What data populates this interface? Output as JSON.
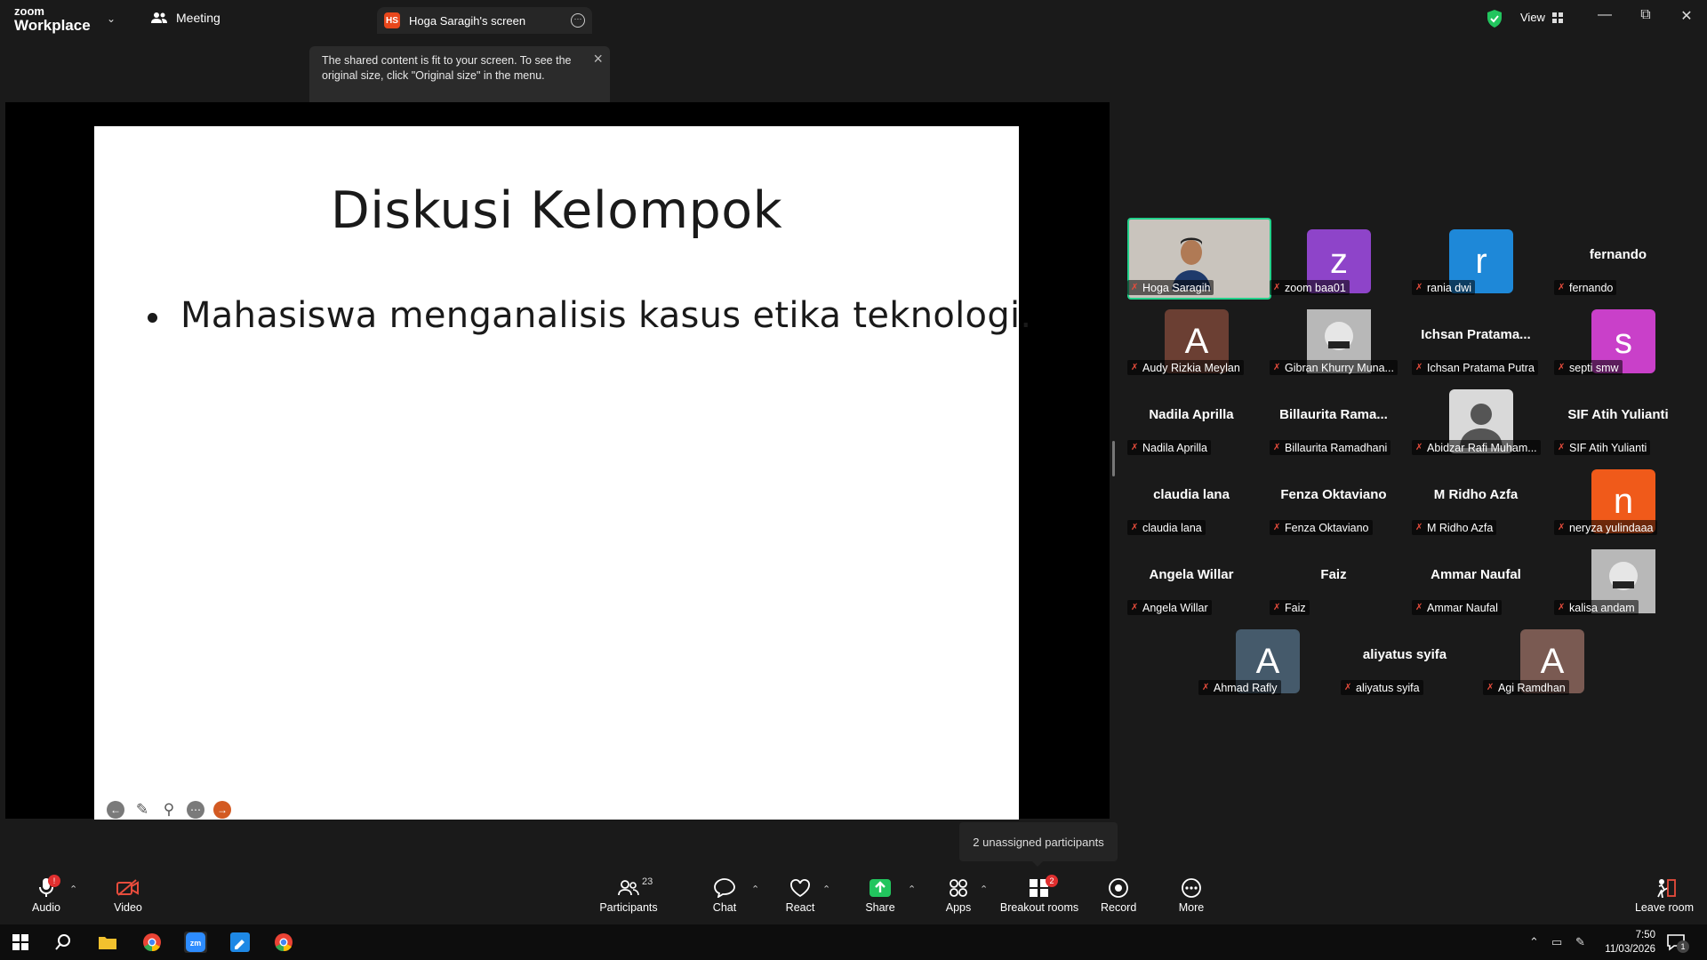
{
  "app": {
    "logo_top": "zoom",
    "logo_bottom": "Workplace",
    "meeting_tab": "Meeting",
    "screen_tab": "Hoga Saragih's screen",
    "screen_badge": "HS",
    "view_label": "View"
  },
  "notice": {
    "text": "The shared content is fit to your screen. To see the original size, click \"Original size\" in the menu."
  },
  "slide": {
    "title": "Diskusi Kelompok",
    "bullet": "Mahasiswa menganalisis kasus etika teknologi."
  },
  "participants_gallery": [
    {
      "name": "Hoga Saragih",
      "display": "video",
      "active": true
    },
    {
      "name": "zoom baa01",
      "display": "avatar",
      "letter": "z",
      "color": "#8e44c9"
    },
    {
      "name": "rania dwi",
      "display": "avatar",
      "letter": "r",
      "color": "#1e88d8"
    },
    {
      "name": "fernando",
      "display": "name",
      "big": "fernando"
    },
    {
      "name": "Audy Rizkia Meylan",
      "display": "avatar",
      "letter": "A",
      "color": "#6b3f33"
    },
    {
      "name": "Gibran Khurry Muna...",
      "display": "image"
    },
    {
      "name": "Ichsan Pratama Putra",
      "display": "name",
      "big": "Ichsan  Pratama..."
    },
    {
      "name": "septi smw",
      "display": "avatar",
      "letter": "s",
      "color": "#c940c9"
    },
    {
      "name": "Nadila Aprilla",
      "display": "name",
      "big": "Nadila Aprilla"
    },
    {
      "name": "Billaurita Ramadhani",
      "display": "name",
      "big": "Billaurita  Rama..."
    },
    {
      "name": "Abidzar Rafi Muham...",
      "display": "photo-placeholder"
    },
    {
      "name": "SIF Atih Yulianti",
      "display": "name",
      "big": "SIF Atih Yulianti"
    },
    {
      "name": "claudia lana",
      "display": "name",
      "big": "claudia lana"
    },
    {
      "name": "Fenza Oktaviano",
      "display": "name",
      "big": "Fenza Oktaviano"
    },
    {
      "name": "M Ridho Azfa",
      "display": "name",
      "big": "M Ridho Azfa"
    },
    {
      "name": "neryza yulindaaa",
      "display": "avatar",
      "letter": "n",
      "color": "#f05a1a"
    },
    {
      "name": "Angela Willar",
      "display": "name",
      "big": "Angela Willar"
    },
    {
      "name": "Faiz",
      "display": "name",
      "big": "Faiz"
    },
    {
      "name": "Ammar Naufal",
      "display": "name",
      "big": "Ammar Naufal"
    },
    {
      "name": "kalisa andam",
      "display": "image"
    },
    {
      "name": "Ahmad Rafly",
      "display": "avatar",
      "letter": "A",
      "color": "#455a6b"
    },
    {
      "name": "aliyatus syifa",
      "display": "name",
      "big": "aliyatus syifa"
    },
    {
      "name": "Agi Ramdhan",
      "display": "avatar",
      "letter": "A",
      "color": "#7a5a52"
    }
  ],
  "tooltip": "2 unassigned participants",
  "toolbar": {
    "audio": "Audio",
    "video": "Video",
    "participants": "Participants",
    "participants_count": "23",
    "chat": "Chat",
    "react": "React",
    "share": "Share",
    "apps": "Apps",
    "breakout": "Breakout rooms",
    "breakout_badge": "2",
    "record": "Record",
    "more": "More",
    "leave": "Leave room"
  },
  "taskbar": {
    "time": "7:50",
    "date": "11/03/2026",
    "notif_count": "1"
  },
  "colors": {
    "active_border": "#23d18b",
    "share_green": "#22c55e",
    "mute_red": "#e74c3c"
  }
}
